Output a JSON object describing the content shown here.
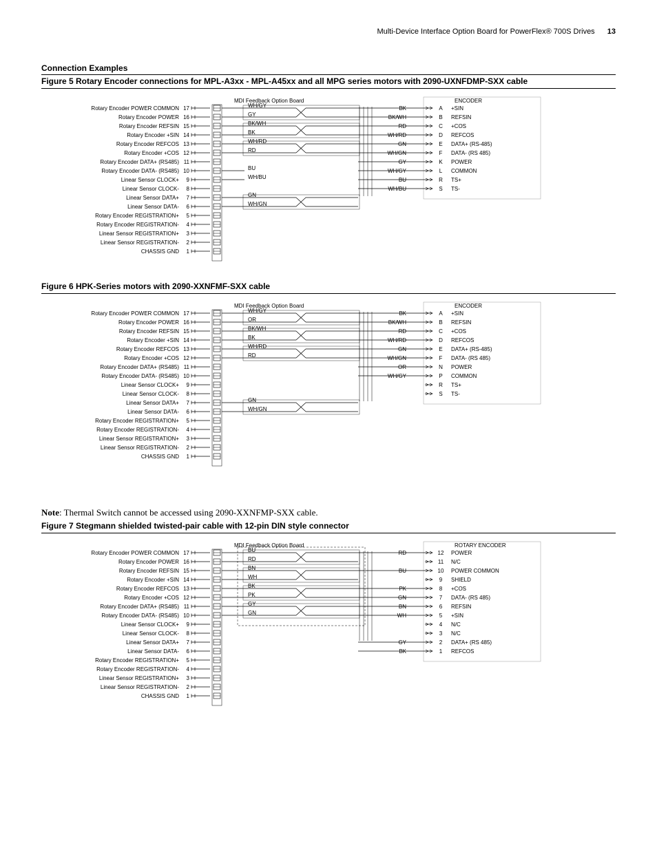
{
  "header": {
    "title": "Multi-Device Interface Option Board for PowerFlex® 700S Drives",
    "page": "13"
  },
  "section_title": "Connection Examples",
  "figures": [
    {
      "id": "fig5",
      "caption": "Figure 5   Rotary Encoder connections for MPL-A3xx - MPL-A45xx and all MPG series motors with 2090-UXNFDMP-SXX cable",
      "board_label": "MDI Feedback Option Board",
      "encoder_label": "ENCODER",
      "rows": [
        {
          "label": "Rotary Encoder POWER COMMON",
          "n": "17"
        },
        {
          "label": "Rotary Encoder POWER",
          "n": "16"
        },
        {
          "label": "Rotary Encoder REFSIN",
          "n": "15"
        },
        {
          "label": "Rotary Encoder +SIN",
          "n": "14"
        },
        {
          "label": "Rotary Encoder REFCOS",
          "n": "13"
        },
        {
          "label": "Rotary Encoder +COS",
          "n": "12"
        },
        {
          "label": "Rotary Encoder DATA+ (RS485)",
          "n": "11"
        },
        {
          "label": "Rotary Encoder DATA- (RS485)",
          "n": "10"
        },
        {
          "label": "Linear Sensor CLOCK+",
          "n": "9"
        },
        {
          "label": "Linear Sensor CLOCK-",
          "n": "8"
        },
        {
          "label": "Linear Sensor DATA+",
          "n": "7"
        },
        {
          "label": "Linear Sensor DATA-",
          "n": "6"
        },
        {
          "label": "Rotary Encoder REGISTRATION+",
          "n": "5"
        },
        {
          "label": "Rotary Encoder REGISTRATION-",
          "n": "4"
        },
        {
          "label": "Linear Sensor REGISTRATION+",
          "n": "3"
        },
        {
          "label": "Linear Sensor REGISTRATION-",
          "n": "2"
        },
        {
          "label": "CHASSIS GND",
          "n": "1"
        }
      ],
      "wires_left": [
        "WH/GY",
        "GY",
        "BK/WH",
        "BK",
        "WH/RD",
        "RD",
        "",
        "BU",
        "WH/BU",
        "",
        "GN",
        "WH/GN"
      ],
      "wires_right": [
        "BK",
        "BK/WH",
        "RD",
        "WH/RD",
        "GN",
        "WH/GN",
        "GY",
        "WH/GY",
        "BU",
        "WH/BU"
      ],
      "enc_pins": [
        {
          "p": "A",
          "l": "+SIN"
        },
        {
          "p": "B",
          "l": "REFSIN"
        },
        {
          "p": "C",
          "l": "+COS"
        },
        {
          "p": "D",
          "l": "REFCOS"
        },
        {
          "p": "E",
          "l": "DATA+ (RS-485)"
        },
        {
          "p": "F",
          "l": "DATA- (RS 485)"
        },
        {
          "p": "K",
          "l": "POWER"
        },
        {
          "p": "L",
          "l": "COMMON"
        },
        {
          "p": "R",
          "l": "TS+"
        },
        {
          "p": "S",
          "l": "TS-"
        }
      ]
    },
    {
      "id": "fig6",
      "caption": "Figure 6   HPK-Series motors with 2090-XXNFMF-SXX cable",
      "board_label": "MDI Feedback Option Board",
      "encoder_label": "ENCODER",
      "rows": [
        {
          "label": "Rotary Encoder POWER COMMON",
          "n": "17"
        },
        {
          "label": "Rotary Encoder POWER",
          "n": "16"
        },
        {
          "label": "Rotary Encoder REFSIN",
          "n": "15"
        },
        {
          "label": "Rotary Encoder +SIN",
          "n": "14"
        },
        {
          "label": "Rotary Encoder REFCOS",
          "n": "13"
        },
        {
          "label": "Rotary Encoder +COS",
          "n": "12"
        },
        {
          "label": "Rotary Encoder DATA+ (RS485)",
          "n": "11"
        },
        {
          "label": "Rotary Encoder DATA- (RS485)",
          "n": "10"
        },
        {
          "label": "Linear Sensor CLOCK+",
          "n": "9"
        },
        {
          "label": "Linear Sensor CLOCK-",
          "n": "8"
        },
        {
          "label": "Linear Sensor DATA+",
          "n": "7"
        },
        {
          "label": "Linear Sensor DATA-",
          "n": "6"
        },
        {
          "label": "Rotary Encoder REGISTRATION+",
          "n": "5"
        },
        {
          "label": "Rotary Encoder REGISTRATION-",
          "n": "4"
        },
        {
          "label": "Linear Sensor REGISTRATION+",
          "n": "3"
        },
        {
          "label": "Linear Sensor REGISTRATION-",
          "n": "2"
        },
        {
          "label": "CHASSIS GND",
          "n": "1"
        }
      ],
      "wires_left": [
        "WH/GY",
        "OR",
        "BK/WH",
        "BK",
        "WH/RD",
        "RD",
        "",
        "",
        "",
        "",
        "GN",
        "WH/GN"
      ],
      "wires_right": [
        "BK",
        "BK/WH",
        "RD",
        "WH/RD",
        "GN",
        "WH/GN",
        "OR",
        "WH/GY",
        "",
        ""
      ],
      "enc_pins": [
        {
          "p": "A",
          "l": "+SIN"
        },
        {
          "p": "B",
          "l": "REFSIN"
        },
        {
          "p": "C",
          "l": "+COS"
        },
        {
          "p": "D",
          "l": "REFCOS"
        },
        {
          "p": "E",
          "l": "DATA+ (RS-485)"
        },
        {
          "p": "F",
          "l": "DATA- (RS 485)"
        },
        {
          "p": "N",
          "l": "POWER"
        },
        {
          "p": "P",
          "l": "COMMON"
        },
        {
          "p": "R",
          "l": "TS+"
        },
        {
          "p": "S",
          "l": "TS-"
        }
      ]
    },
    {
      "id": "fig7",
      "caption": "Figure 7   Stegmann shielded twisted-pair cable with 12-pin DIN style connector",
      "note": "Note: Thermal Switch cannot be accessed using 2090-XXNFMP-SXX cable.",
      "board_label": "MDI Feedback Option Board",
      "encoder_label": "ROTARY ENCODER",
      "rows": [
        {
          "label": "Rotary Encoder POWER COMMON",
          "n": "17"
        },
        {
          "label": "Rotary Encoder POWER",
          "n": "16"
        },
        {
          "label": "Rotary Encoder REFSIN",
          "n": "15"
        },
        {
          "label": "Rotary Encoder +SIN",
          "n": "14"
        },
        {
          "label": "Rotary Encoder REFCOS",
          "n": "13"
        },
        {
          "label": "Rotary Encoder +COS",
          "n": "12"
        },
        {
          "label": "Rotary Encoder DATA+ (RS485)",
          "n": "11"
        },
        {
          "label": "Rotary Encoder DATA- (RS485)",
          "n": "10"
        },
        {
          "label": "Linear Sensor CLOCK+",
          "n": "9"
        },
        {
          "label": "Linear Sensor CLOCK-",
          "n": "8"
        },
        {
          "label": "Linear Sensor DATA+",
          "n": "7"
        },
        {
          "label": "Linear Sensor DATA-",
          "n": "6"
        },
        {
          "label": "Rotary Encoder REGISTRATION+",
          "n": "5"
        },
        {
          "label": "Rotary Encoder REGISTRATION-",
          "n": "4"
        },
        {
          "label": "Linear Sensor REGISTRATION+",
          "n": "3"
        },
        {
          "label": "Linear Sensor REGISTRATION-",
          "n": "2"
        },
        {
          "label": "CHASSIS GND",
          "n": "1"
        }
      ],
      "wires_left": [
        "BU",
        "RD",
        "BN",
        "WH",
        "BK",
        "PK",
        "GY",
        "GN"
      ],
      "wires_right": [
        "RD",
        "",
        "BU",
        "",
        "PK",
        "GN",
        "BN",
        "WH",
        "",
        "",
        "GY",
        "BK"
      ],
      "enc_pins": [
        {
          "p": "12",
          "l": "POWER"
        },
        {
          "p": "11",
          "l": "N/C"
        },
        {
          "p": "10",
          "l": "POWER COMMON"
        },
        {
          "p": "9",
          "l": "SHIELD"
        },
        {
          "p": "8",
          "l": "+COS"
        },
        {
          "p": "7",
          "l": "DATA- (RS 485)"
        },
        {
          "p": "6",
          "l": "REFSIN"
        },
        {
          "p": "5",
          "l": "+SIN"
        },
        {
          "p": "4",
          "l": "N/C"
        },
        {
          "p": "3",
          "l": "N/C"
        },
        {
          "p": "2",
          "l": "DATA+ (RS 485)"
        },
        {
          "p": "1",
          "l": "REFCOS"
        }
      ]
    }
  ]
}
